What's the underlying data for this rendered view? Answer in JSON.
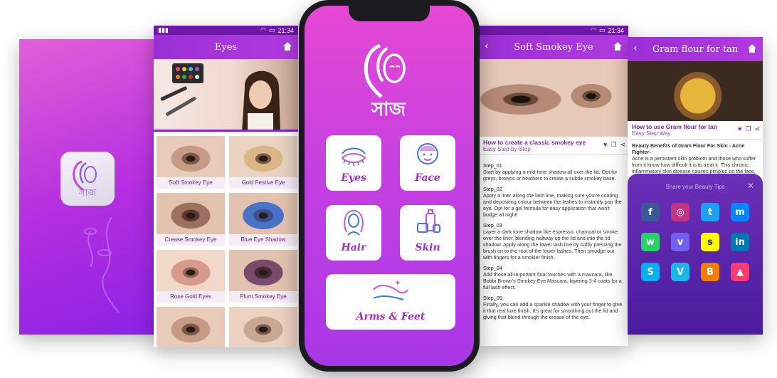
{
  "status": {
    "time": "21:34"
  },
  "splash": {
    "logo_text": "সাজ"
  },
  "eyes_screen": {
    "title": "Eyes",
    "items": [
      {
        "label": "Soft Smokey Eye"
      },
      {
        "label": "Gold Festive Eye"
      },
      {
        "label": "Crease Smokey Eye"
      },
      {
        "label": "Blue Eye Shadow"
      },
      {
        "label": "Rose Gold Eyes"
      },
      {
        "label": "Plum Smokey Eye"
      },
      {
        "label": ""
      },
      {
        "label": ""
      }
    ]
  },
  "home_screen": {
    "logo_text": "সাজ",
    "categories": [
      {
        "label": "Eyes",
        "icon": "eye-icon"
      },
      {
        "label": "Face",
        "icon": "face-icon"
      },
      {
        "label": "Hair",
        "icon": "hair-icon"
      },
      {
        "label": "Skin",
        "icon": "skincare-icon"
      },
      {
        "label": "Arms & Feet",
        "icon": "feet-icon"
      }
    ]
  },
  "smokey_screen": {
    "title": "Soft Smokey Eye",
    "subtitle": "How to create a classic smokey eye",
    "tagline": "Easy Step-by-Step",
    "steps": [
      {
        "name": "Step_01",
        "text": "Start by applying a mid-tone shadow all over the lid. Opt for greys, browns or heathers to create a subtle smokey base."
      },
      {
        "name": "Step_02",
        "text": "Apply a liner along the lash line, making sure you're coating and depositing colour between the lashes to instantly pop the eye. Opt for a gel formula for easy application that won't budge all night!"
      },
      {
        "name": "Step_03",
        "text": "Layer a dark tone shadow like espresso, charcoal or smoke over the liner, blending halfway up the lid and into the lid shadow. Apply along the lower lash line by softly pressing the brush on to the root of the lower lashes. Then smudge out with fingers for a smokier finish."
      },
      {
        "name": "Step_04",
        "text": "Add those all-important final touches with a mascara, like Bobbi Brown's Smokey Eye Mascara, layering 3-4 coats for a full lash effect."
      },
      {
        "name": "Step_05",
        "text": "Finally, you can add a sparkle shadow with your finger to give it that real luxe finish. It's great for smoothing out the lid and giving that blend through the crease of the eye."
      }
    ]
  },
  "gram_screen": {
    "title": "Gram flour for tan",
    "subtitle": "How to use Gram flour for tan",
    "tagline": "Easy Step Way",
    "body_title": "Beauty Benefits of Gram Flour For Skin - Acne Fighter-",
    "body": "Acne is a persistent skin problem and those who suffer from it know how difficult it is to treat it. This chronic, inflammatory skin disease causes pimples on the face, shoulders, back, neck, chest, and upper arms. This condition that",
    "share_title": "Share your Beauty Tips",
    "share_icons": [
      {
        "name": "facebook-icon",
        "glyph": "f",
        "color": "#3b5998"
      },
      {
        "name": "instagram-icon",
        "glyph": "◎",
        "color": "#c13584"
      },
      {
        "name": "twitter-icon",
        "glyph": "t",
        "color": "#1da1f2"
      },
      {
        "name": "messenger-icon",
        "glyph": "m",
        "color": "#0084ff"
      },
      {
        "name": "whatsapp-icon",
        "glyph": "w",
        "color": "#25d366"
      },
      {
        "name": "viber-icon",
        "glyph": "v",
        "color": "#7360f2"
      },
      {
        "name": "snapchat-icon",
        "glyph": "s",
        "color": "#fffc00"
      },
      {
        "name": "linkedin-icon",
        "glyph": "in",
        "color": "#0077b5"
      },
      {
        "name": "skype-icon",
        "glyph": "S",
        "color": "#00aff0"
      },
      {
        "name": "vimeo-icon",
        "glyph": "V",
        "color": "#1ab7ea"
      },
      {
        "name": "blogger-icon",
        "glyph": "B",
        "color": "#f57d00"
      },
      {
        "name": "tinder-icon",
        "glyph": "▲",
        "color": "#fe3c72"
      }
    ]
  }
}
